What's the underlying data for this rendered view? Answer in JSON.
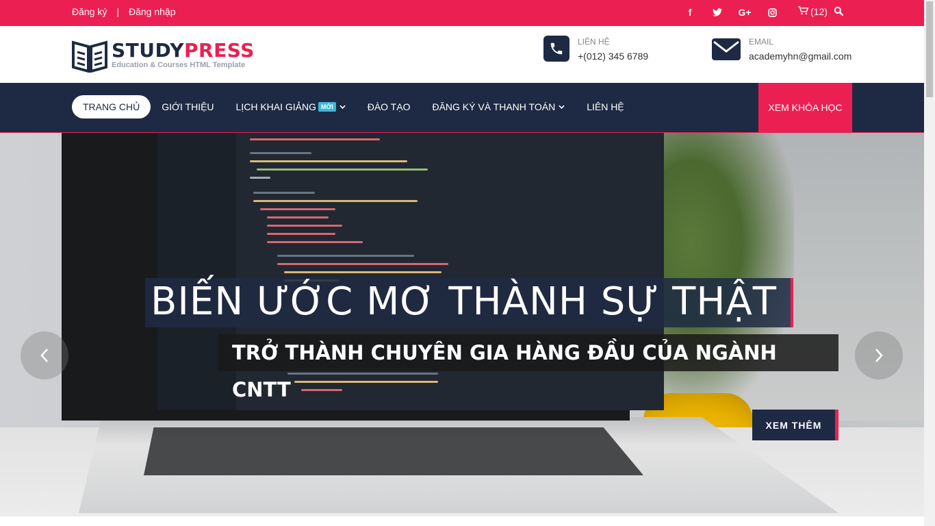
{
  "topbar": {
    "register": "Đăng ký",
    "separator": "|",
    "login": "Đăng nhập",
    "social": [
      "facebook-icon",
      "twitter-icon",
      "google-plus-icon",
      "instagram-icon"
    ],
    "social_glyphs": [
      "f",
      "t",
      "G+",
      "◎"
    ],
    "cart_count": "(12)"
  },
  "header": {
    "brand_study": "STUDY",
    "brand_press": "PRESS",
    "tagline": "Education & Courses HTML Template",
    "contact_label": "LIÊN HỆ",
    "contact_value": "+(012) 345 6789",
    "email_label": "EMAIL",
    "email_value": "academyhn@gmail.com"
  },
  "nav": {
    "items": [
      {
        "label": "TRANG CHỦ"
      },
      {
        "label": "GIỚI THIỆU"
      },
      {
        "label": "LỊCH KHAI GIẢNG",
        "badge": "MỚI"
      },
      {
        "label": "ĐÀO TẠO"
      },
      {
        "label": "ĐĂNG KÝ VÀ THANH TOÁN"
      },
      {
        "label": "LIÊN HỆ"
      }
    ],
    "cta": "XEM KHÓA HỌC"
  },
  "hero": {
    "headline": "BIẾN ƯỚC MƠ THÀNH SỰ THẬT",
    "subheadline": "TRỞ THÀNH CHUYÊN GIA HÀNG ĐẦU CỦA NGÀNH CNTT",
    "button": "XEM THÊM",
    "prev": "‹",
    "next": "›"
  },
  "colors": {
    "accent": "#ec1f52",
    "navy": "#1e2a44",
    "badge": "#3fb6d8"
  }
}
